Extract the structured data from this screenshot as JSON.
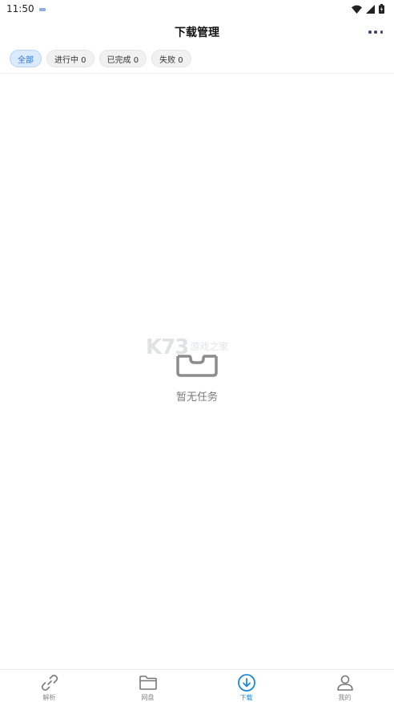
{
  "status": {
    "time": "11:50"
  },
  "header": {
    "title": "下载管理"
  },
  "filters": [
    {
      "label": "全部",
      "active": true
    },
    {
      "label": "进行中 0",
      "active": false
    },
    {
      "label": "已完成 0",
      "active": false
    },
    {
      "label": "失败 0",
      "active": false
    }
  ],
  "empty": {
    "text": "暂无任务"
  },
  "watermark": {
    "big": "K73",
    "small": "游戏之家"
  },
  "nav": {
    "items": [
      {
        "label": "解析",
        "icon": "link-icon"
      },
      {
        "label": "网盘",
        "icon": "folder-icon"
      },
      {
        "label": "下载",
        "icon": "download-icon"
      },
      {
        "label": "我的",
        "icon": "user-icon"
      }
    ],
    "active_color": "#1e88d6",
    "inactive_color": "#777777"
  }
}
